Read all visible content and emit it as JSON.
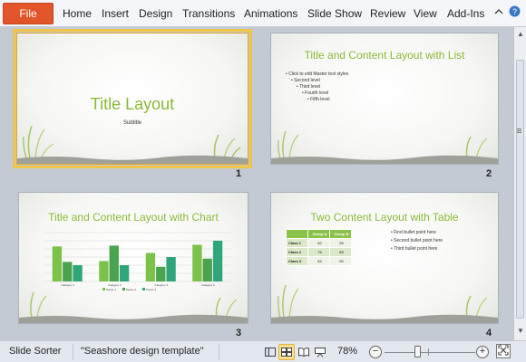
{
  "ribbon": {
    "file_label": "File",
    "tabs": [
      "Home",
      "Insert",
      "Design",
      "Transitions",
      "Animations",
      "Slide Show",
      "Review",
      "View",
      "Add-Ins"
    ],
    "minimize_icon": "chevron-up-icon",
    "help_icon": "help-icon"
  },
  "slides": [
    {
      "number": "1",
      "title": "Title Layout",
      "subtitle": "Subtitle"
    },
    {
      "number": "2",
      "title": "Title and Content Layout with List",
      "bullets": [
        "Click to edit Master text styles",
        "Second level",
        "Third level",
        "Fourth level",
        "Fifth level"
      ]
    },
    {
      "number": "3",
      "title": "Title and Content Layout with Chart"
    },
    {
      "number": "4",
      "title": "Two Content Layout with Table",
      "table": {
        "headers": [
          "",
          "Group A",
          "Group B"
        ],
        "rows": [
          [
            "Class 1",
            "82",
            "95"
          ],
          [
            "Class 2",
            "76",
            "88"
          ],
          [
            "Class 3",
            "84",
            "90"
          ]
        ]
      },
      "bullets": [
        "First bullet point here",
        "Second bullet point here",
        "Third bullet point here"
      ]
    }
  ],
  "chart_data": {
    "type": "bar",
    "title": "Title and Content Layout with Chart",
    "categories": [
      "Category 1",
      "Category 2",
      "Category 3",
      "Category 4"
    ],
    "series": [
      {
        "name": "Series 1",
        "values": [
          4.3,
          2.5,
          3.5,
          4.5
        ]
      },
      {
        "name": "Series 2",
        "values": [
          2.4,
          4.4,
          1.8,
          2.8
        ]
      },
      {
        "name": "Series 3",
        "values": [
          2,
          2,
          3,
          5
        ]
      }
    ],
    "ylim": [
      0,
      6
    ],
    "legend": "bottom",
    "colors": [
      "#7cc14a",
      "#4aa34f",
      "#2fa57a"
    ]
  },
  "status": {
    "view_name": "Slide Sorter",
    "theme_name": "\"Seashore design template\"",
    "zoom": "78%"
  },
  "colors": {
    "accent_green": "#8bb93a",
    "selection": "#f0c447",
    "file_tab": "#e2552a"
  }
}
